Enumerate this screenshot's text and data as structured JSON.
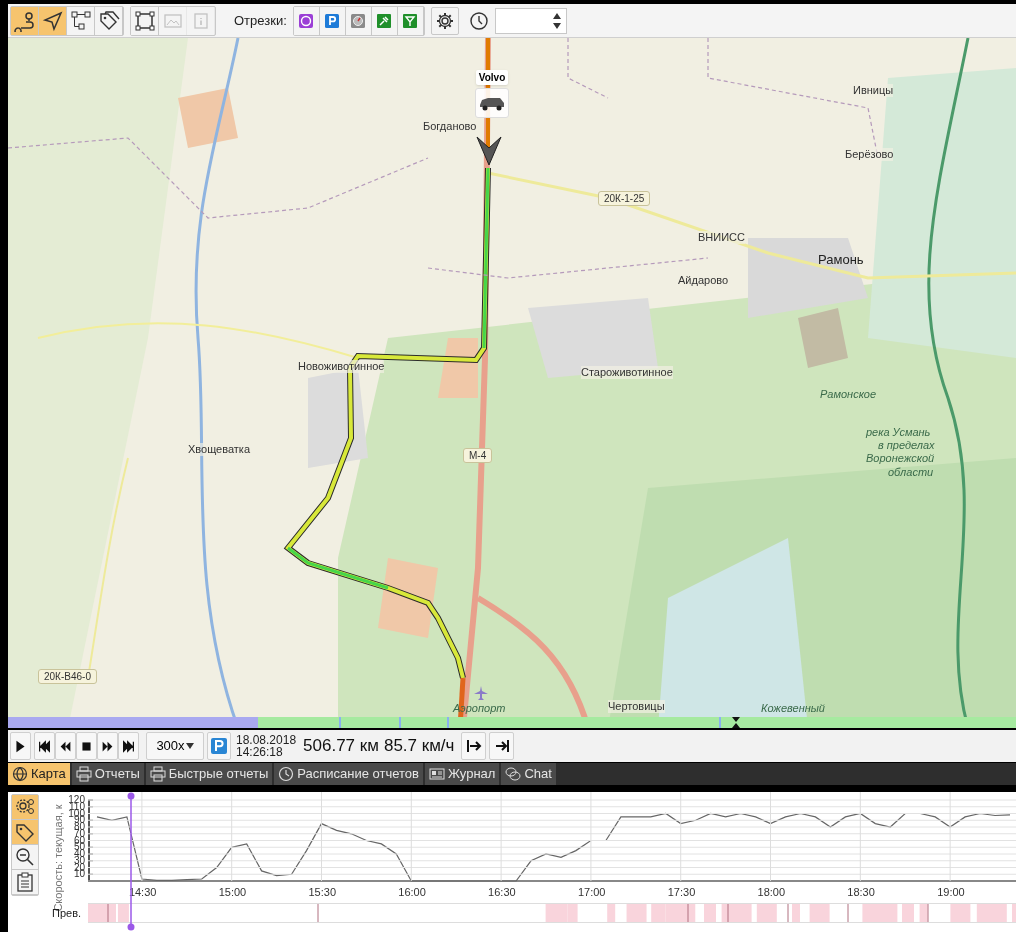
{
  "toolbar": {
    "tools": [
      {
        "selected": true,
        "disabled": false
      },
      {
        "selected": true,
        "disabled": false
      },
      {
        "selected": false,
        "disabled": false
      },
      {
        "selected": false,
        "disabled": false
      }
    ],
    "view_tools": [
      {
        "disabled": false
      },
      {
        "disabled": true
      },
      {
        "disabled": true
      }
    ],
    "segments_label": "Отрезки:",
    "segments": [
      {
        "color": "#9b3fd6"
      },
      {
        "color": "#1e7bd8"
      },
      {
        "color": "#8a8a8a"
      },
      {
        "color": "#1f8f2a"
      },
      {
        "color": "#1f8f2a"
      }
    ]
  },
  "map": {
    "vehicle": {
      "label": "Volvo"
    },
    "labels": [
      {
        "text": "Ивницы",
        "kind": "place"
      },
      {
        "text": "Богданово",
        "kind": "place"
      },
      {
        "text": "Берёзово",
        "kind": "place"
      },
      {
        "text": "20К-1-25",
        "kind": "road"
      },
      {
        "text": "ВНИИСС",
        "kind": "place"
      },
      {
        "text": "Рамонь",
        "kind": "town"
      },
      {
        "text": "Айдарово",
        "kind": "place"
      },
      {
        "text": "Новоживотинное",
        "kind": "place"
      },
      {
        "text": "Староживотинное",
        "kind": "place"
      },
      {
        "text": "Рамонское",
        "kind": "area"
      },
      {
        "text": "река Усмань",
        "kind": "area"
      },
      {
        "text": "в пределах",
        "kind": "area"
      },
      {
        "text": "Воронежской",
        "kind": "area"
      },
      {
        "text": "области",
        "kind": "area"
      },
      {
        "text": "Хвощеватка",
        "kind": "place"
      },
      {
        "text": "М-4",
        "kind": "road"
      },
      {
        "text": "20К-В46-0",
        "kind": "road"
      },
      {
        "text": "Аэропорт",
        "kind": "area"
      },
      {
        "text": "Чертовицы",
        "kind": "place"
      },
      {
        "text": "Кожевенный",
        "kind": "area"
      }
    ]
  },
  "playback": {
    "speed_select": "300x",
    "date": "18.08.2018",
    "time": "14:26:18",
    "distance": "506.77 км",
    "speed": "85.7 км/ч"
  },
  "tabs": [
    {
      "label": "Карта",
      "selected": true
    },
    {
      "label": "Отчеты",
      "selected": false
    },
    {
      "label": "Быстрые отчеты",
      "selected": false
    },
    {
      "label": "Расписание отчетов",
      "selected": false
    },
    {
      "label": "Журнал",
      "selected": false
    },
    {
      "label": "Chat",
      "selected": false
    }
  ],
  "graph": {
    "side_buttons": [
      {
        "selected": true
      },
      {
        "selected": true
      },
      {
        "selected": false
      },
      {
        "selected": false
      }
    ],
    "chart_data": {
      "type": "line",
      "ylabel": "Скорость: текущая, к",
      "x": [
        855,
        860,
        865,
        870,
        875,
        880,
        885,
        890,
        895,
        900,
        905,
        910,
        915,
        920,
        925,
        930,
        935,
        940,
        945,
        950,
        955,
        960,
        965,
        970,
        975,
        980,
        985,
        990,
        995,
        1000,
        1005,
        1010,
        1015,
        1020,
        1025,
        1030,
        1035,
        1040,
        1045,
        1050,
        1055,
        1060,
        1065,
        1070,
        1075,
        1080,
        1085,
        1090,
        1095,
        1100,
        1105,
        1110,
        1115,
        1120,
        1125,
        1130,
        1135,
        1140,
        1145,
        1150,
        1155,
        1160
      ],
      "series": [
        {
          "color": "#666666",
          "values": [
            95,
            90,
            95,
            3,
            1,
            1,
            2,
            3,
            20,
            50,
            55,
            15,
            8,
            10,
            45,
            85,
            75,
            70,
            60,
            55,
            40,
            0,
            0,
            0,
            0,
            0,
            0,
            0,
            0,
            30,
            40,
            35,
            45,
            60,
            60,
            95,
            95,
            95,
            100,
            85,
            90,
            100,
            95,
            100,
            95,
            85,
            95,
            100,
            95,
            80,
            95,
            100,
            85,
            80,
            100,
            100,
            95,
            80,
            95,
            100,
            97,
            98
          ]
        }
      ],
      "xlim": [
        852,
        1162
      ],
      "ylim": [
        0,
        120
      ],
      "yticks": [
        10,
        20,
        30,
        40,
        50,
        60,
        70,
        80,
        90,
        100,
        110,
        120
      ],
      "xticks": [
        {
          "value": 870,
          "label": "14:30"
        },
        {
          "value": 900,
          "label": "15:00"
        },
        {
          "value": 930,
          "label": "15:30"
        },
        {
          "value": 960,
          "label": "16:00"
        },
        {
          "value": 990,
          "label": "16:30"
        },
        {
          "value": 1020,
          "label": "17:00"
        },
        {
          "value": 1050,
          "label": "17:30"
        },
        {
          "value": 1080,
          "label": "18:00"
        },
        {
          "value": 1110,
          "label": "18:30"
        },
        {
          "value": 1140,
          "label": "19:00"
        }
      ]
    },
    "strip_label": "Прев."
  }
}
